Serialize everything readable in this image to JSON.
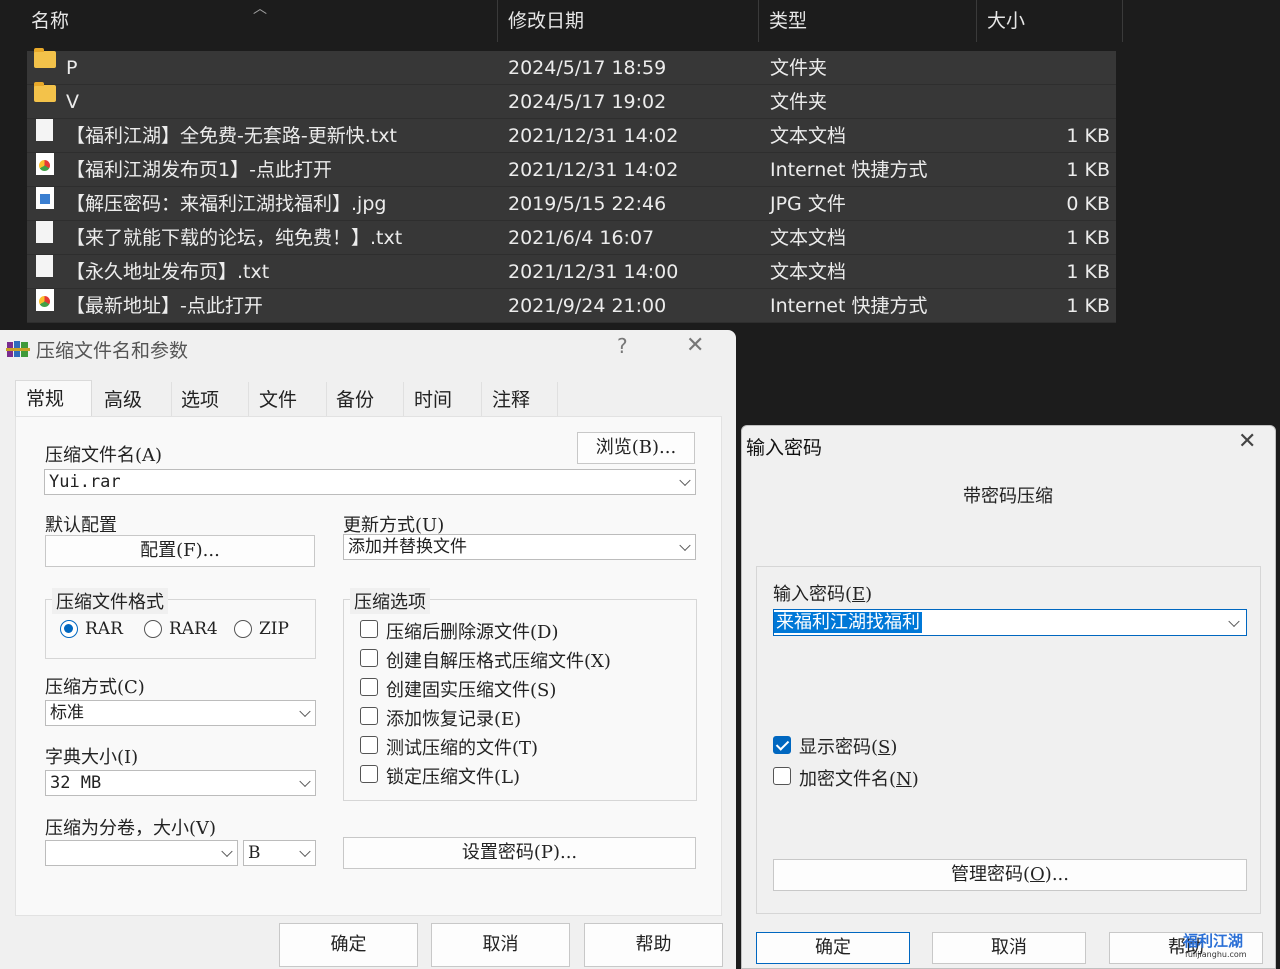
{
  "explorer": {
    "columns": [
      "名称",
      "修改日期",
      "类型",
      "大小"
    ],
    "files": [
      {
        "icon": "folder-icon",
        "name": "P",
        "date": "2024/5/17 18:59",
        "type": "文件夹",
        "size": ""
      },
      {
        "icon": "folder-icon",
        "name": "V",
        "date": "2024/5/17 19:02",
        "type": "文件夹",
        "size": ""
      },
      {
        "icon": "text-file-icon",
        "name": "【福利江湖】全免费-无套路-更新快.txt",
        "date": "2021/12/31 14:02",
        "type": "文本文档",
        "size": "1 KB"
      },
      {
        "icon": "internet-shortcut-icon",
        "name": "【福利江湖发布页1】-点此打开",
        "date": "2021/12/31 14:02",
        "type": "Internet 快捷方式",
        "size": "1 KB"
      },
      {
        "icon": "image-file-icon",
        "name": "【解压密码：来福利江湖找福利】.jpg",
        "date": "2019/5/15 22:46",
        "type": "JPG 文件",
        "size": "0 KB"
      },
      {
        "icon": "text-file-icon",
        "name": "【来了就能下载的论坛，纯免费！】.txt",
        "date": "2021/6/4 16:07",
        "type": "文本文档",
        "size": "1 KB"
      },
      {
        "icon": "text-file-icon",
        "name": "【永久地址发布页】.txt",
        "date": "2021/12/31 14:00",
        "type": "文本文档",
        "size": "1 KB"
      },
      {
        "icon": "internet-shortcut-icon",
        "name": "【最新地址】-点此打开",
        "date": "2021/9/24 21:00",
        "type": "Internet 快捷方式",
        "size": "1 KB"
      }
    ]
  },
  "rar_dialog": {
    "title": "压缩文件名和参数",
    "help_glyph": "?",
    "close_glyph": "✕",
    "tabs": [
      "常规",
      "高级",
      "选项",
      "文件",
      "备份",
      "时间",
      "注释"
    ],
    "archive_name_label": "压缩文件名(A)",
    "browse_button": "浏览(B)...",
    "archive_name_value": "Yui.rar",
    "default_profile_label": "默认配置",
    "profiles_button": "配置(F)...",
    "update_mode_label": "更新方式(U)",
    "update_mode_value": "添加并替换文件",
    "format_group": "压缩文件格式",
    "formats": [
      "RAR",
      "RAR4",
      "ZIP"
    ],
    "selected_format": "RAR",
    "method_label": "压缩方式(C)",
    "method_value": "标准",
    "dict_label": "字典大小(I)",
    "dict_value": "32 MB",
    "split_label": "压缩为分卷，大小(V)",
    "split_value": "",
    "split_unit": "B",
    "options_group": "压缩选项",
    "options": [
      {
        "label": "压缩后删除源文件(D)",
        "checked": false
      },
      {
        "label": "创建自解压格式压缩文件(X)",
        "checked": false
      },
      {
        "label": "创建固实压缩文件(S)",
        "checked": false
      },
      {
        "label": "添加恢复记录(E)",
        "checked": false
      },
      {
        "label": "测试压缩的文件(T)",
        "checked": false
      },
      {
        "label": "锁定压缩文件(L)",
        "checked": false
      }
    ],
    "set_password_button": "设置密码(P)...",
    "ok": "确定",
    "cancel": "取消",
    "help": "帮助"
  },
  "password_dialog": {
    "title": "输入密码",
    "close_glyph": "✕",
    "heading": "带密码压缩",
    "input_label": "输入密码(",
    "input_label_key": "E",
    "input_label_end": ")",
    "password_value": "来福利江湖找福利",
    "show_password": {
      "label": "显示密码(",
      "key": "S",
      "end": ")",
      "checked": true
    },
    "encrypt_names": {
      "label": "加密文件名(",
      "key": "N",
      "end": ")",
      "checked": false
    },
    "organize_button": "管理密码(",
    "organize_key": "O",
    "organize_end": ")...",
    "ok": "确定",
    "cancel": "取消",
    "help": "帮助"
  },
  "watermark": {
    "text": "福利江湖",
    "url": "fulijianghu.com"
  }
}
